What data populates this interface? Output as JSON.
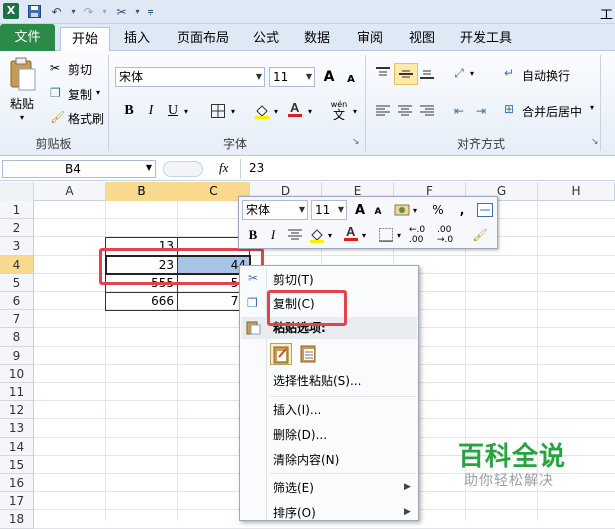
{
  "quick_access": {
    "logo": "X",
    "title_fragment": "工"
  },
  "tabs": {
    "file": "文件",
    "home": "开始",
    "insert": "插入",
    "layout": "页面布局",
    "formula": "公式",
    "data": "数据",
    "review": "审阅",
    "view": "视图",
    "dev": "开发工具"
  },
  "ribbon": {
    "clipboard": {
      "paste": "粘贴",
      "cut": "剪切",
      "copy": "复制",
      "painter": "格式刷",
      "label": "剪贴板"
    },
    "font": {
      "name": "宋体",
      "size": "11",
      "bold": "B",
      "italic": "I",
      "underline": "U",
      "grow": "A",
      "shrink": "A",
      "wen": "wén",
      "wen_char": "文",
      "label": "字体",
      "underline_arrow": "▾"
    },
    "align": {
      "wrap": "自动换行",
      "merge": "合并后居中",
      "label": "对齐方式"
    }
  },
  "formula_bar": {
    "name_box": "B4",
    "fx": "fx",
    "value": "23"
  },
  "columns": [
    "A",
    "B",
    "C",
    "D",
    "E",
    "F",
    "G",
    "H"
  ],
  "rows": [
    "1",
    "2",
    "3",
    "4",
    "5",
    "6",
    "7",
    "8",
    "9",
    "10",
    "11",
    "12",
    "13",
    "14",
    "15",
    "16",
    "17",
    "18"
  ],
  "cells": {
    "B3": "13",
    "C3": "2",
    "B4": "23",
    "C4": "44",
    "B5": "555",
    "C5": "54",
    "B6": "666",
    "C6": "77"
  },
  "mini_toolbar": {
    "font": "宋体",
    "size": "11",
    "percent": "%",
    "comma": ",",
    "bold": "B",
    "italic": "I",
    "dec_inc": "←.0 .00",
    "dec_dec": ".00 →.0"
  },
  "context_menu": {
    "cut": "剪切(T)",
    "copy": "复制(C)",
    "paste_options": "粘贴选项:",
    "paste_special": "选择性粘贴(S)...",
    "insert": "插入(I)...",
    "delete": "删除(D)...",
    "clear": "清除内容(N)",
    "filter": "筛选(E)",
    "sort": "排序(O)"
  },
  "watermark": {
    "title": "百科全说",
    "subtitle": "助你轻松解决"
  },
  "colors": {
    "excel_green": "#2a8a47",
    "highlight_red": "#e2434c",
    "selected_header": "#f9d98e"
  }
}
